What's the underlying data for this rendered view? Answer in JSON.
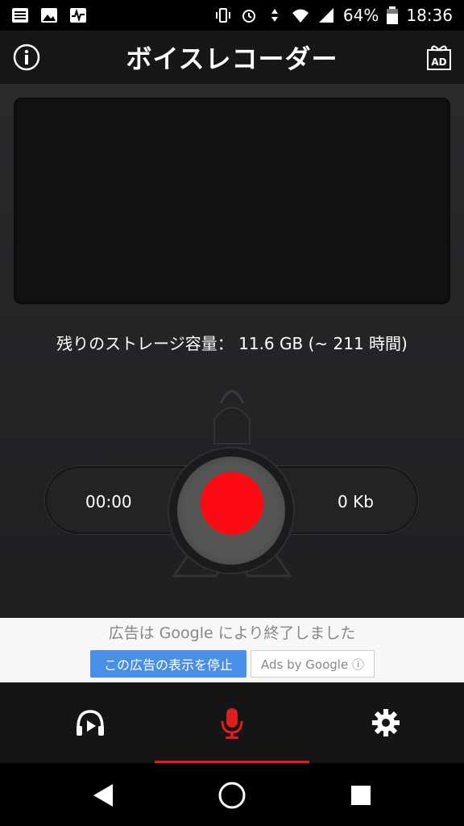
{
  "status": {
    "battery": "64%",
    "time": "18:36"
  },
  "header": {
    "title": "ボイスレコーダー",
    "ad_icon_label": "AD"
  },
  "storage": {
    "text": "残りのストレージ容量： 11.6 GB (~ 211 時間)"
  },
  "recorder": {
    "elapsed": "00:00",
    "size": "0 Kb"
  },
  "ad": {
    "closed_text": "広告は Google により終了しました",
    "stop_button": "この広告の表示を停止",
    "ads_by_google": "Ads by Google ⓘ"
  },
  "colors": {
    "record_red": "#ff0a14",
    "nav_active": "#e01e1e",
    "ad_button_blue": "#4a8fe7"
  }
}
